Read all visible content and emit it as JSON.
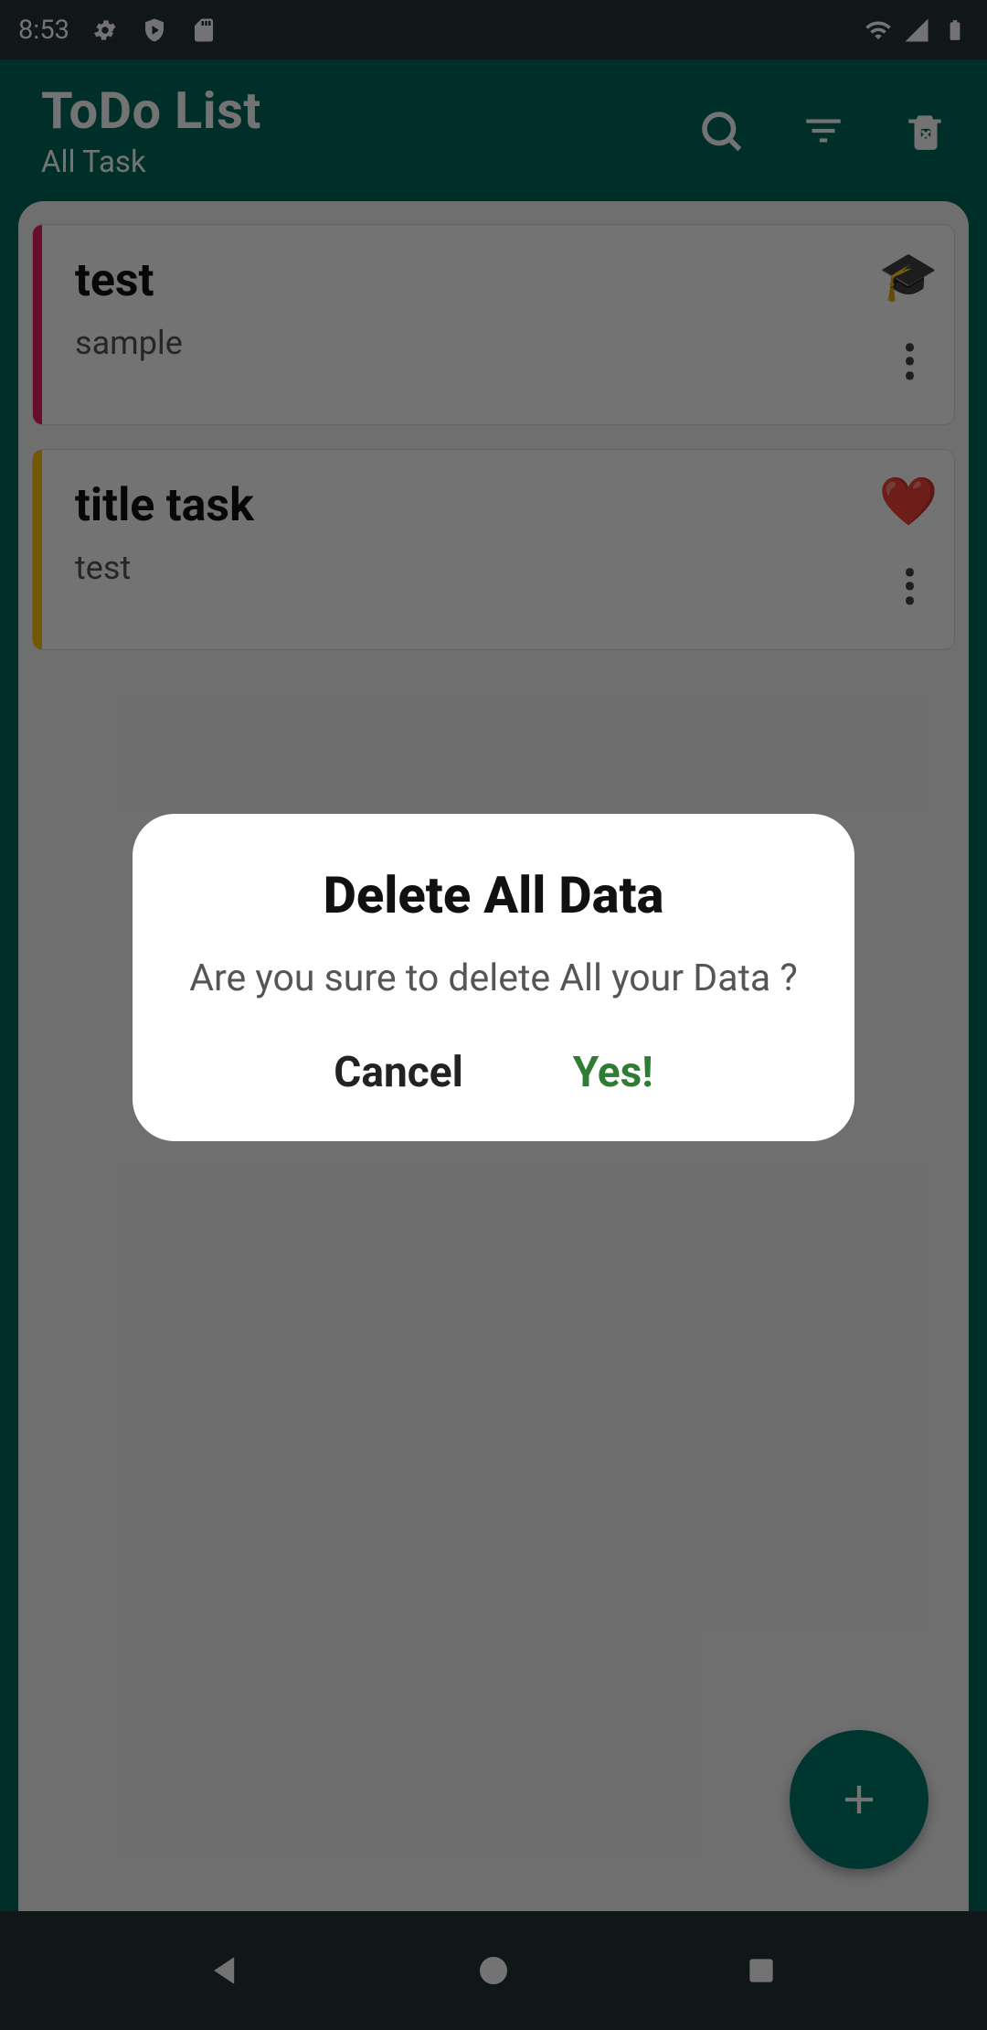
{
  "status_bar": {
    "time": "8:53"
  },
  "app_bar": {
    "title": "ToDo List",
    "subtitle": "All Task"
  },
  "tasks": [
    {
      "title": "test",
      "description": "sample",
      "stripe_color": "#E91E63",
      "category_icon": "🎓"
    },
    {
      "title": "title task",
      "description": "test",
      "stripe_color": "#FFC107",
      "category_icon": "❤️"
    }
  ],
  "dialog": {
    "title": "Delete All Data",
    "message": "Are you sure to delete All your Data ?",
    "cancel_label": "Cancel",
    "confirm_label": "Yes!"
  }
}
